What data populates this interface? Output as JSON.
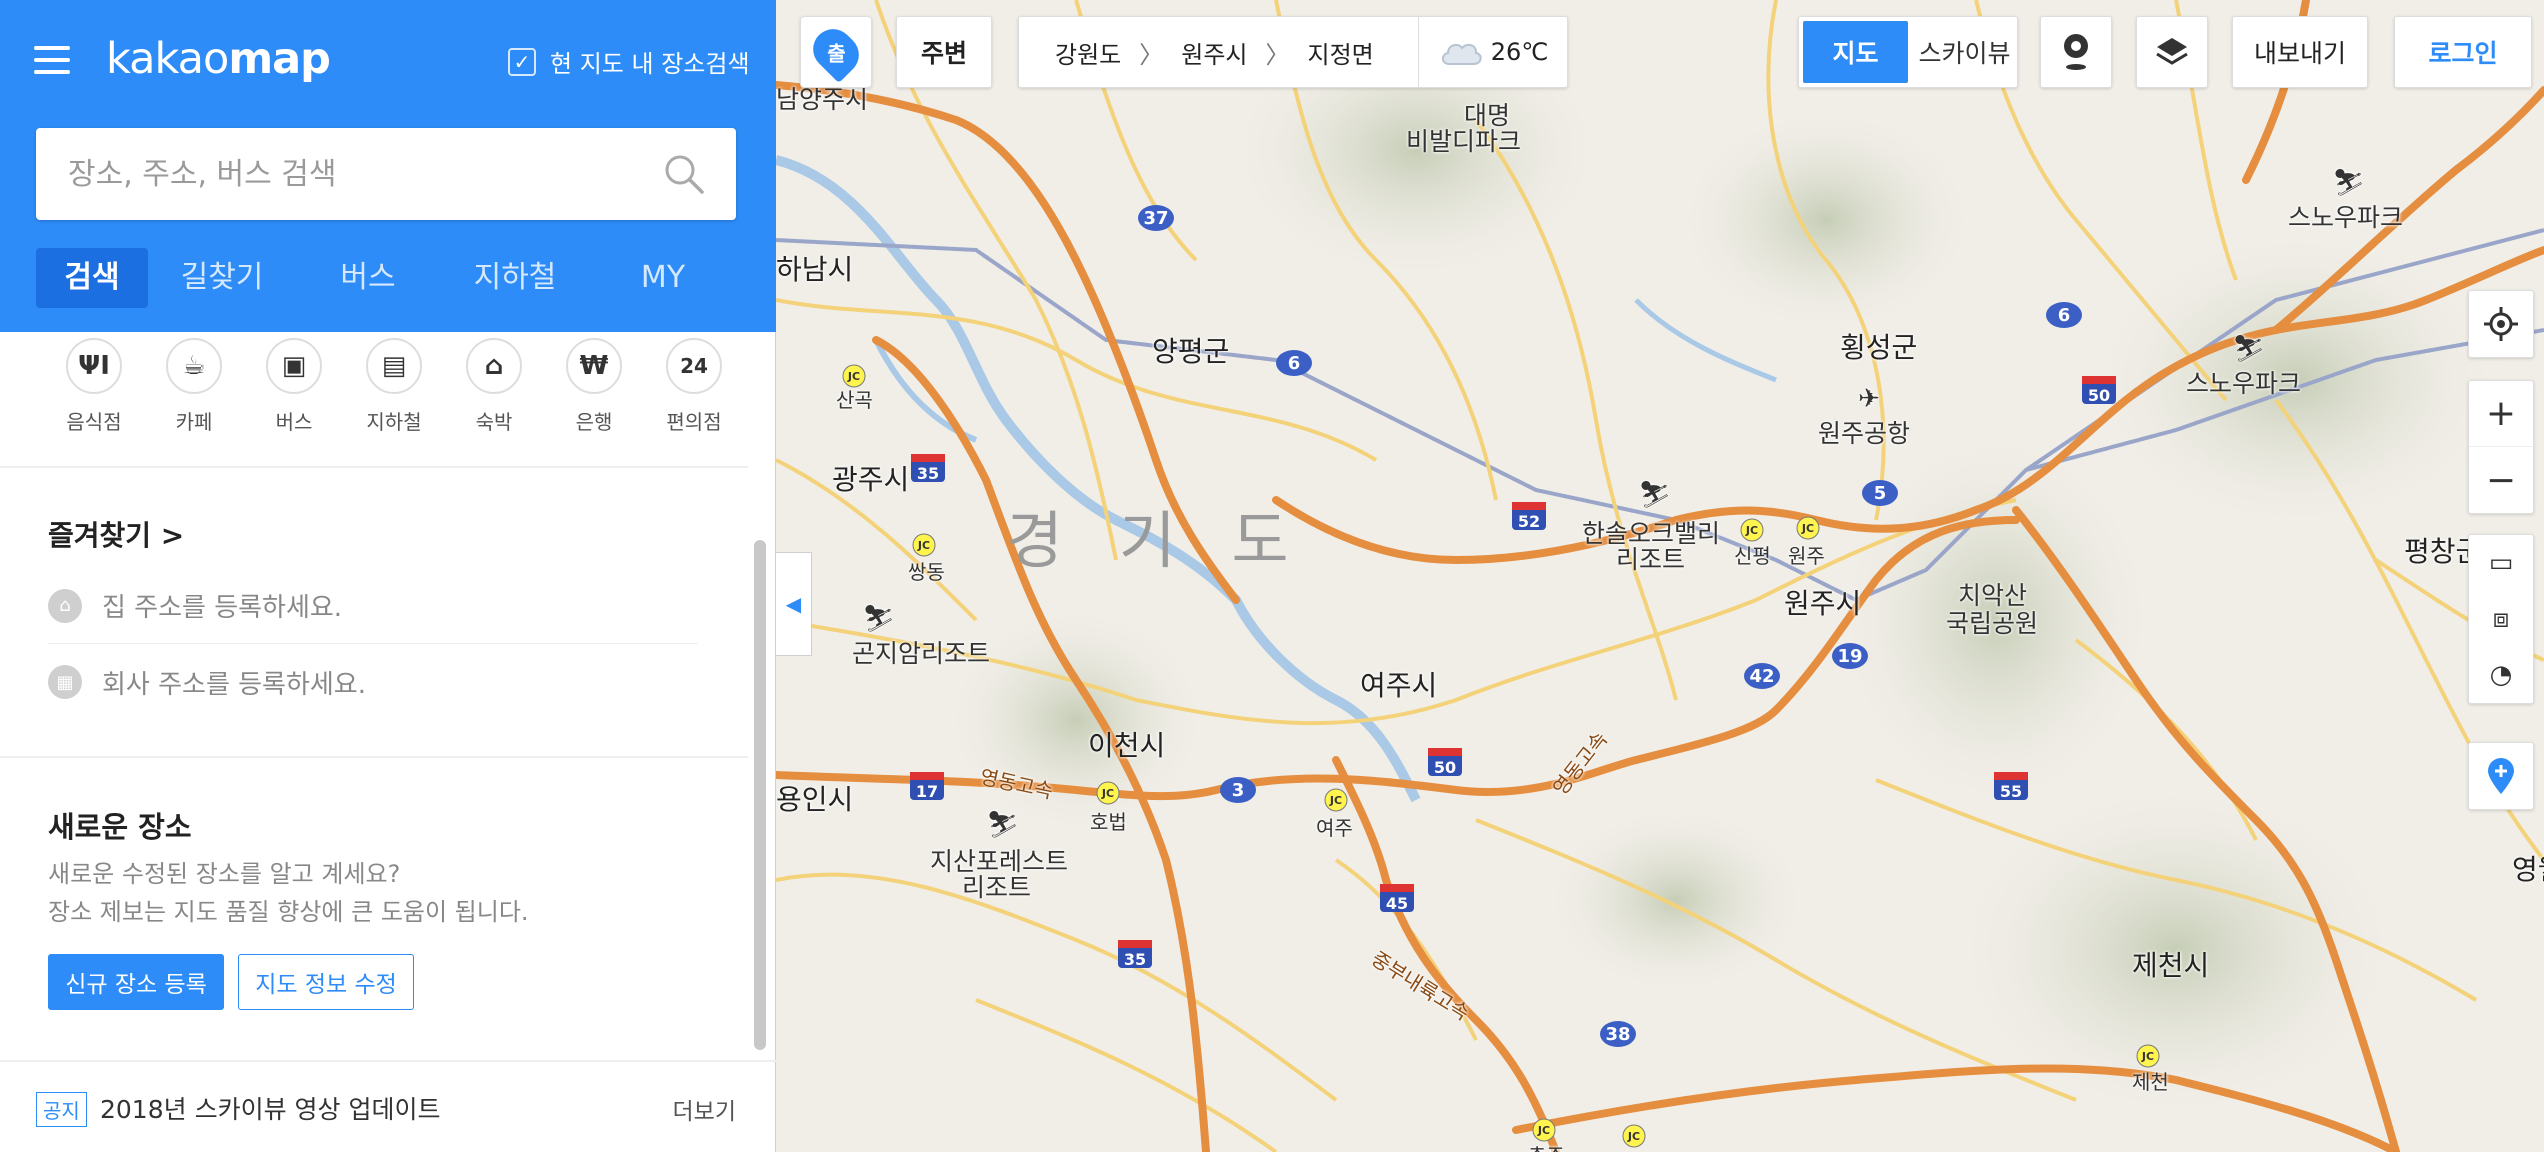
{
  "logo": {
    "light": "kakao",
    "bold": "map"
  },
  "panel": {
    "checkbox_label": "현 지도 내 장소검색",
    "search_placeholder": "장소, 주소, 버스 검색",
    "tabs": [
      {
        "label": "검색",
        "active": true
      },
      {
        "label": "길찾기"
      },
      {
        "label": "버스"
      },
      {
        "label": "지하철"
      },
      {
        "label": "MY"
      }
    ],
    "categories": [
      {
        "label": "음식점",
        "icon": "restaurant-icon",
        "glyph": "ΨΙ"
      },
      {
        "label": "카페",
        "icon": "cafe-icon",
        "glyph": "☕"
      },
      {
        "label": "버스",
        "icon": "bus-icon",
        "glyph": "▣"
      },
      {
        "label": "지하철",
        "icon": "subway-icon",
        "glyph": "▤"
      },
      {
        "label": "숙박",
        "icon": "bed-icon",
        "glyph": "⌂"
      },
      {
        "label": "은행",
        "icon": "bank-icon",
        "glyph": "₩"
      },
      {
        "label": "편의점",
        "icon": "convenience-store-icon",
        "glyph": "24"
      }
    ],
    "favorites_title": "즐겨찾기 >",
    "home_text": "집 주소를 등록하세요.",
    "work_text": "회사 주소를 등록하세요.",
    "new_place_title": "새로운 장소",
    "new_place_desc1": "새로운 수정된 장소를 알고 계세요?",
    "new_place_desc2": "장소 제보는 지도 품질 향상에 큰 도움이 됩니다.",
    "new_place_button": "신규 장소 등록",
    "edit_map_button": "지도 정보 수정",
    "notice_tag": "공지",
    "notice_text": "2018년 스카이뷰 영상 업데이트",
    "notice_more": "더보기"
  },
  "map_toolbar": {
    "origin_badge": "출",
    "nearby": "주변",
    "breadcrumb": [
      "강원도",
      "원주시",
      "지정면"
    ],
    "weather": "26℃",
    "map_type_map": "지도",
    "map_type_sky": "스카이뷰",
    "export": "내보내기",
    "login": "로그인"
  },
  "map_labels": {
    "region": "경 기 도",
    "cities": [
      "양평군",
      "광주시",
      "이천시",
      "여주시",
      "횡성군",
      "원주시",
      "제천시",
      "하남시",
      "남양주시",
      "용인시",
      "평창군",
      "영월"
    ],
    "places": [
      "대명",
      "비발디파크",
      "원주공항",
      "한솔오크밸리",
      "리조트",
      "치악산",
      "국립공원",
      "곤지암리조트",
      "지산포레스트",
      "리조트",
      "스노우파크",
      "스노우파크"
    ],
    "small": [
      "산곡",
      "쌍동",
      "호법",
      "여주",
      "신평",
      "원주",
      "제천",
      "충주"
    ],
    "highways": [
      "영동고속",
      "영동고속",
      "중부내륙고속"
    ],
    "routes": [
      "37",
      "6",
      "6",
      "5",
      "42",
      "19",
      "3",
      "38"
    ],
    "expressways": [
      "35",
      "52",
      "50",
      "17",
      "45",
      "35",
      "50",
      "55"
    ]
  },
  "colors": {
    "brand": "#2d8cf7",
    "road": "#f3c14c",
    "highway": "#e08a3c",
    "water": "#a9c9e6"
  }
}
